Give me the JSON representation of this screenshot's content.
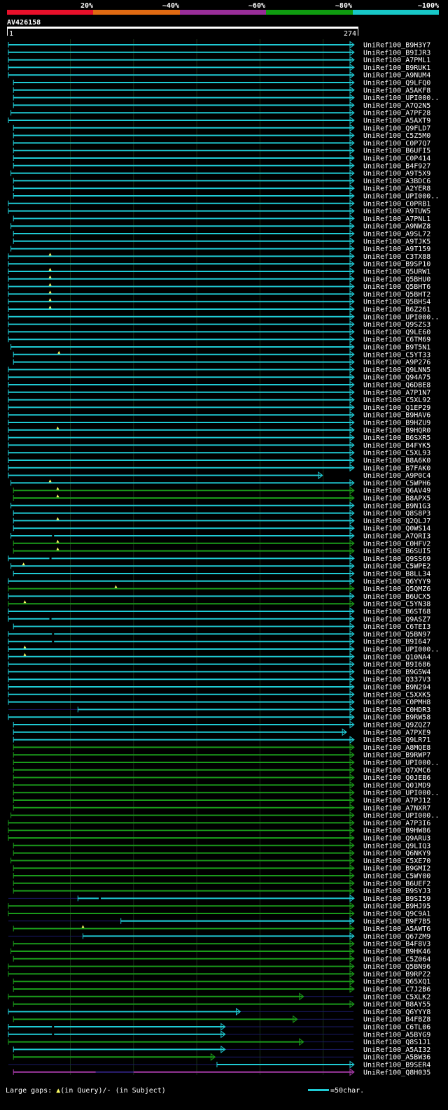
{
  "query": {
    "name": "AV426158",
    "start": "1",
    "end": "274"
  },
  "identity_scale": {
    "labels": [
      "20%",
      "~40%",
      "~60%",
      "~80%",
      "~100%"
    ],
    "colors": [
      "#e8102a",
      "#e06a12",
      "#982d98",
      "#0f9c10",
      "#18c8c8"
    ]
  },
  "colors": {
    "cyan": "#1fcad4",
    "green": "#1a9a1a",
    "purple": "#a63aa8",
    "navy": "#1a1a66",
    "grid": "#183018",
    "bg": "#000000"
  },
  "chart_data": {
    "type": "alignment_overview",
    "query_length": 274,
    "hits": [
      {
        "name": "UniRef100_B9H3Y7",
        "s": 1,
        "e": 274,
        "c": "cyan"
      },
      {
        "name": "UniRef100_B9IJR3",
        "s": 1,
        "e": 274,
        "c": "cyan"
      },
      {
        "name": "UniRef100_A7PML1",
        "s": 1,
        "e": 274,
        "c": "cyan"
      },
      {
        "name": "UniRef100_B9RUK1",
        "s": 1,
        "e": 274,
        "c": "cyan"
      },
      {
        "name": "UniRef100_A9NUM4",
        "s": 1,
        "e": 274,
        "c": "cyan"
      },
      {
        "name": "UniRef100_Q9LFQ0",
        "s": 5,
        "e": 274,
        "c": "cyan"
      },
      {
        "name": "UniRef100_A5AKF8",
        "s": 5,
        "e": 274,
        "c": "cyan"
      },
      {
        "name": "UniRef100_UPI000..",
        "s": 5,
        "e": 274,
        "c": "cyan"
      },
      {
        "name": "UniRef100_A7Q2N5",
        "s": 5,
        "e": 274,
        "c": "cyan"
      },
      {
        "name": "UniRef100_A7PF28",
        "s": 3,
        "e": 274,
        "c": "cyan"
      },
      {
        "name": "UniRef100_A5AXT9",
        "s": 1,
        "e": 274,
        "c": "cyan"
      },
      {
        "name": "UniRef100_Q9FLD7",
        "s": 5,
        "e": 274,
        "c": "cyan"
      },
      {
        "name": "UniRef100_C5Z5M0",
        "s": 5,
        "e": 274,
        "c": "cyan"
      },
      {
        "name": "UniRef100_C0P7Q7",
        "s": 5,
        "e": 274,
        "c": "cyan"
      },
      {
        "name": "UniRef100_B6UFI5",
        "s": 5,
        "e": 274,
        "c": "cyan"
      },
      {
        "name": "UniRef100_C0P414",
        "s": 5,
        "e": 274,
        "c": "cyan"
      },
      {
        "name": "UniRef100_B4F927",
        "s": 5,
        "e": 274,
        "c": "cyan"
      },
      {
        "name": "UniRef100_A9T5X9",
        "s": 3,
        "e": 274,
        "c": "cyan"
      },
      {
        "name": "UniRef100_A3BDC6",
        "s": 5,
        "e": 274,
        "c": "cyan"
      },
      {
        "name": "UniRef100_A2YER8",
        "s": 5,
        "e": 274,
        "c": "cyan"
      },
      {
        "name": "UniRef100_UPI000..",
        "s": 5,
        "e": 274,
        "c": "cyan"
      },
      {
        "name": "UniRef100_C0PRB1",
        "s": 1,
        "e": 274,
        "c": "cyan"
      },
      {
        "name": "UniRef100_A9TUW5",
        "s": 1,
        "e": 274,
        "c": "cyan"
      },
      {
        "name": "UniRef100_A7PNL1",
        "s": 5,
        "e": 274,
        "c": "cyan"
      },
      {
        "name": "UniRef100_A9NWZ8",
        "s": 3,
        "e": 274,
        "c": "cyan"
      },
      {
        "name": "UniRef100_A9SL72",
        "s": 5,
        "e": 274,
        "c": "cyan"
      },
      {
        "name": "UniRef100_A9TJK5",
        "s": 5,
        "e": 274,
        "c": "cyan"
      },
      {
        "name": "UniRef100_A9T159",
        "s": 3,
        "e": 274,
        "c": "cyan"
      },
      {
        "name": "UniRef100_C3TX88",
        "s": 1,
        "e": 274,
        "c": "cyan",
        "gap": 34
      },
      {
        "name": "UniRef100_B9SP10",
        "s": 1,
        "e": 274,
        "c": "cyan"
      },
      {
        "name": "UniRef100_Q5URW1",
        "s": 1,
        "e": 274,
        "c": "cyan",
        "gap": 34
      },
      {
        "name": "UniRef100_Q5BHU0",
        "s": 1,
        "e": 274,
        "c": "cyan",
        "gap": 34
      },
      {
        "name": "UniRef100_Q5BHT6",
        "s": 1,
        "e": 274,
        "c": "cyan",
        "gap": 34
      },
      {
        "name": "UniRef100_Q5BHT2",
        "s": 1,
        "e": 274,
        "c": "cyan",
        "gap": 34
      },
      {
        "name": "UniRef100_Q5BHS4",
        "s": 1,
        "e": 274,
        "c": "cyan",
        "gap": 34
      },
      {
        "name": "UniRef100_B6Z261",
        "s": 1,
        "e": 274,
        "c": "cyan",
        "gap": 34
      },
      {
        "name": "UniRef100_UPI000..",
        "s": 1,
        "e": 274,
        "c": "cyan"
      },
      {
        "name": "UniRef100_Q9SZS3",
        "s": 1,
        "e": 274,
        "c": "cyan"
      },
      {
        "name": "UniRef100_Q9LE60",
        "s": 1,
        "e": 274,
        "c": "cyan"
      },
      {
        "name": "UniRef100_C6TM69",
        "s": 1,
        "e": 274,
        "c": "cyan"
      },
      {
        "name": "UniRef100_B9T5N1",
        "s": 3,
        "e": 274,
        "c": "cyan"
      },
      {
        "name": "UniRef100_C5YT33",
        "s": 5,
        "e": 274,
        "c": "cyan",
        "gap": 41
      },
      {
        "name": "UniRef100_A9P276",
        "s": 5,
        "e": 274,
        "c": "cyan"
      },
      {
        "name": "UniRef100_Q9LNN5",
        "s": 1,
        "e": 274,
        "c": "cyan"
      },
      {
        "name": "UniRef100_Q94A75",
        "s": 1,
        "e": 274,
        "c": "cyan"
      },
      {
        "name": "UniRef100_Q6DBE8",
        "s": 1,
        "e": 274,
        "c": "cyan"
      },
      {
        "name": "UniRef100_A7P1N7",
        "s": 1,
        "e": 274,
        "c": "cyan"
      },
      {
        "name": "UniRef100_C5XL92",
        "s": 1,
        "e": 274,
        "c": "cyan"
      },
      {
        "name": "UniRef100_Q1EP29",
        "s": 1,
        "e": 274,
        "c": "cyan"
      },
      {
        "name": "UniRef100_B9HAV6",
        "s": 1,
        "e": 274,
        "c": "cyan"
      },
      {
        "name": "UniRef100_B9HZU9",
        "s": 1,
        "e": 274,
        "c": "cyan"
      },
      {
        "name": "UniRef100_B9HQR0",
        "s": 1,
        "e": 274,
        "c": "cyan",
        "gap": 40
      },
      {
        "name": "UniRef100_B6SXR5",
        "s": 1,
        "e": 274,
        "c": "cyan"
      },
      {
        "name": "UniRef100_B4FYK5",
        "s": 1,
        "e": 274,
        "c": "cyan"
      },
      {
        "name": "UniRef100_C5XL93",
        "s": 1,
        "e": 274,
        "c": "cyan"
      },
      {
        "name": "UniRef100_B8A6K0",
        "s": 1,
        "e": 274,
        "c": "cyan"
      },
      {
        "name": "UniRef100_B7FAK0",
        "s": 1,
        "e": 274,
        "c": "cyan"
      },
      {
        "name": "UniRef100_A9P0C4",
        "s": 1,
        "e": 249,
        "c": "cyan"
      },
      {
        "name": "UniRef100_C5WPH6",
        "s": 3,
        "e": 274,
        "c": "cyan",
        "gap": 34
      },
      {
        "name": "UniRef100_Q6AV49",
        "s": 5,
        "e": 274,
        "c": "green",
        "gap": 40
      },
      {
        "name": "UniRef100_B8APX5",
        "s": 5,
        "e": 274,
        "c": "green",
        "gap": 40
      },
      {
        "name": "UniRef100_B9N1G3",
        "s": 3,
        "e": 274,
        "c": "cyan"
      },
      {
        "name": "UniRef100_Q8S8P3",
        "s": 5,
        "e": 274,
        "c": "cyan"
      },
      {
        "name": "UniRef100_Q2QLJ7",
        "s": 5,
        "e": 274,
        "c": "cyan",
        "gap": 40
      },
      {
        "name": "UniRef100_Q0WS14",
        "s": 5,
        "e": 274,
        "c": "cyan"
      },
      {
        "name": "UniRef100_A7QRI3",
        "s": 3,
        "e": 274,
        "c": "cyan",
        "sgap": 36
      },
      {
        "name": "UniRef100_C0HFV2",
        "s": 5,
        "e": 274,
        "c": "green",
        "gap": 40
      },
      {
        "name": "UniRef100_B6SUI5",
        "s": 5,
        "e": 274,
        "c": "green",
        "gap": 40
      },
      {
        "name": "UniRef100_Q9SS69",
        "s": 1,
        "e": 274,
        "c": "cyan",
        "sgap": 34
      },
      {
        "name": "UniRef100_C5WPE2",
        "s": 3,
        "e": 274,
        "c": "cyan",
        "gap": 13
      },
      {
        "name": "UniRef100_B8LL34",
        "s": 5,
        "e": 274,
        "c": "cyan"
      },
      {
        "name": "UniRef100_Q6YYY9",
        "s": 1,
        "e": 274,
        "c": "cyan"
      },
      {
        "name": "UniRef100_Q5QMZ6",
        "s": 1,
        "e": 274,
        "c": "green",
        "gap": 86
      },
      {
        "name": "UniRef100_B6UCX5",
        "s": 1,
        "e": 274,
        "c": "cyan"
      },
      {
        "name": "UniRef100_C5YN38",
        "s": 1,
        "e": 274,
        "c": "green",
        "gap": 14
      },
      {
        "name": "UniRef100_B6ST68",
        "s": 1,
        "e": 274,
        "c": "cyan"
      },
      {
        "name": "UniRef100_Q9ASZ7",
        "s": 1,
        "e": 274,
        "c": "cyan",
        "sgap": 34
      },
      {
        "name": "UniRef100_C6TEI3",
        "s": 5,
        "e": 274,
        "c": "cyan"
      },
      {
        "name": "UniRef100_Q5BN97",
        "s": 1,
        "e": 274,
        "c": "cyan",
        "sgap": 36
      },
      {
        "name": "UniRef100_B9I647",
        "s": 1,
        "e": 274,
        "c": "cyan",
        "sgap": 36
      },
      {
        "name": "UniRef100_UPI000..",
        "s": 1,
        "e": 274,
        "c": "cyan",
        "gap": 14
      },
      {
        "name": "UniRef100_Q10NA4",
        "s": 1,
        "e": 274,
        "c": "cyan",
        "gap": 14
      },
      {
        "name": "UniRef100_B9I686",
        "s": 1,
        "e": 274,
        "c": "cyan"
      },
      {
        "name": "UniRef100_B9G5W4",
        "s": 1,
        "e": 274,
        "c": "cyan"
      },
      {
        "name": "UniRef100_Q337V3",
        "s": 1,
        "e": 274,
        "c": "cyan"
      },
      {
        "name": "UniRef100_B9N294",
        "s": 1,
        "e": 274,
        "c": "cyan"
      },
      {
        "name": "UniRef100_C5XXK5",
        "s": 1,
        "e": 274,
        "c": "cyan"
      },
      {
        "name": "UniRef100_C0PMH8",
        "s": 1,
        "e": 274,
        "c": "cyan"
      },
      {
        "name": "UniRef100_C0HDR3",
        "s": 56,
        "e": 274,
        "c": "cyan",
        "pre": "navy"
      },
      {
        "name": "UniRef100_B9RW58",
        "s": 1,
        "e": 274,
        "c": "cyan"
      },
      {
        "name": "UniRef100_Q9ZQZ7",
        "s": 5,
        "e": 274,
        "c": "cyan"
      },
      {
        "name": "UniRef100_A7PXE9",
        "s": 5,
        "e": 268,
        "c": "cyan"
      },
      {
        "name": "UniRef100_Q9LR71",
        "s": 5,
        "e": 274,
        "c": "cyan"
      },
      {
        "name": "UniRef100_A8MQE8",
        "s": 5,
        "e": 274,
        "c": "green"
      },
      {
        "name": "UniRef100_B9RWP7",
        "s": 5,
        "e": 274,
        "c": "green"
      },
      {
        "name": "UniRef100_UPI000..",
        "s": 5,
        "e": 274,
        "c": "green"
      },
      {
        "name": "UniRef100_Q7XMC6",
        "s": 5,
        "e": 274,
        "c": "green"
      },
      {
        "name": "UniRef100_Q0JEB6",
        "s": 5,
        "e": 274,
        "c": "green"
      },
      {
        "name": "UniRef100_Q01MD9",
        "s": 5,
        "e": 274,
        "c": "green"
      },
      {
        "name": "UniRef100_UPI000..",
        "s": 5,
        "e": 274,
        "c": "green"
      },
      {
        "name": "UniRef100_A7PJ12",
        "s": 5,
        "e": 274,
        "c": "green"
      },
      {
        "name": "UniRef100_A7NXR7",
        "s": 5,
        "e": 274,
        "c": "green"
      },
      {
        "name": "UniRef100_UPI000..",
        "s": 3,
        "e": 274,
        "c": "green"
      },
      {
        "name": "UniRef100_A7P3I6",
        "s": 1,
        "e": 274,
        "c": "green"
      },
      {
        "name": "UniRef100_B9HW86",
        "s": 1,
        "e": 274,
        "c": "green"
      },
      {
        "name": "UniRef100_Q9ARU3",
        "s": 1,
        "e": 274,
        "c": "green"
      },
      {
        "name": "UniRef100_Q9LIQ3",
        "s": 5,
        "e": 274,
        "c": "green"
      },
      {
        "name": "UniRef100_Q6NKY9",
        "s": 5,
        "e": 274,
        "c": "green"
      },
      {
        "name": "UniRef100_C5XE70",
        "s": 3,
        "e": 274,
        "c": "green"
      },
      {
        "name": "UniRef100_B9GMI2",
        "s": 5,
        "e": 274,
        "c": "green"
      },
      {
        "name": "UniRef100_C5WY00",
        "s": 5,
        "e": 274,
        "c": "green"
      },
      {
        "name": "UniRef100_B6UEF2",
        "s": 5,
        "e": 274,
        "c": "green"
      },
      {
        "name": "UniRef100_B9SYJ3",
        "s": 5,
        "e": 274,
        "c": "green"
      },
      {
        "name": "UniRef100_B9SI59",
        "s": 56,
        "e": 274,
        "c": "cyan",
        "pre": "navy",
        "sgap": 73
      },
      {
        "name": "UniRef100_B9HJ95",
        "s": 1,
        "e": 274,
        "c": "green"
      },
      {
        "name": "UniRef100_Q9C9A1",
        "s": 1,
        "e": 274,
        "c": "green"
      },
      {
        "name": "UniRef100_B9F7B5",
        "s": 90,
        "e": 274,
        "c": "cyan",
        "pre": "navy"
      },
      {
        "name": "UniRef100_A5AWT6",
        "s": 5,
        "e": 274,
        "c": "green",
        "gap": 60
      },
      {
        "name": "UniRef100_Q67ZM9",
        "s": 60,
        "e": 274,
        "c": "cyan",
        "pre": "navy"
      },
      {
        "name": "UniRef100_B4F8V3",
        "s": 5,
        "e": 274,
        "c": "green"
      },
      {
        "name": "UniRef100_B9HK46",
        "s": 3,
        "e": 274,
        "c": "green"
      },
      {
        "name": "UniRef100_C5Z064",
        "s": 5,
        "e": 274,
        "c": "green"
      },
      {
        "name": "UniRef100_Q5BN96",
        "s": 1,
        "e": 274,
        "c": "green"
      },
      {
        "name": "UniRef100_B9RPZ2",
        "s": 1,
        "e": 274,
        "c": "green"
      },
      {
        "name": "UniRef100_Q65XQ1",
        "s": 5,
        "e": 274,
        "c": "green"
      },
      {
        "name": "UniRef100_C7J2B6",
        "s": 5,
        "e": 274,
        "c": "green"
      },
      {
        "name": "UniRef100_C5XLK2",
        "s": 1,
        "e": 234,
        "c": "green",
        "post": "navy"
      },
      {
        "name": "UniRef100_B8AY55",
        "s": 5,
        "e": 274,
        "c": "green"
      },
      {
        "name": "UniRef100_Q6YYY8",
        "s": 1,
        "e": 184,
        "c": "cyan",
        "post": "navy"
      },
      {
        "name": "UniRef100_B4FBZ8",
        "s": 5,
        "e": 229,
        "c": "green",
        "post": "navy"
      },
      {
        "name": "UniRef100_C6TL06",
        "s": 1,
        "e": 172,
        "c": "cyan",
        "post": "navy",
        "sgap": 36
      },
      {
        "name": "UniRef100_A5BYG9",
        "s": 1,
        "e": 172,
        "c": "cyan",
        "post": "navy",
        "sgap": 36
      },
      {
        "name": "UniRef100_Q8S1J1",
        "s": 1,
        "e": 234,
        "c": "green",
        "post": "navy"
      },
      {
        "name": "UniRef100_A5AI32",
        "s": 5,
        "e": 172,
        "c": "cyan",
        "post": "navy"
      },
      {
        "name": "UniRef100_A5BW36",
        "s": 5,
        "e": 164,
        "c": "green",
        "post": "navy"
      },
      {
        "name": "UniRef100_B9SER4",
        "s": 166,
        "e": 274,
        "c": "cyan",
        "pre": "navy"
      },
      {
        "name": "UniRef100_Q8H035",
        "s": 5,
        "e": 274,
        "c": "purple",
        "mid": "navy"
      }
    ]
  },
  "footer": {
    "gaps_prefix": "Large gaps: ",
    "in_query": "(in Query)",
    "slash": "/",
    "dash": "-",
    "in_subject": " (in Subject)",
    "scale": "=50char."
  }
}
